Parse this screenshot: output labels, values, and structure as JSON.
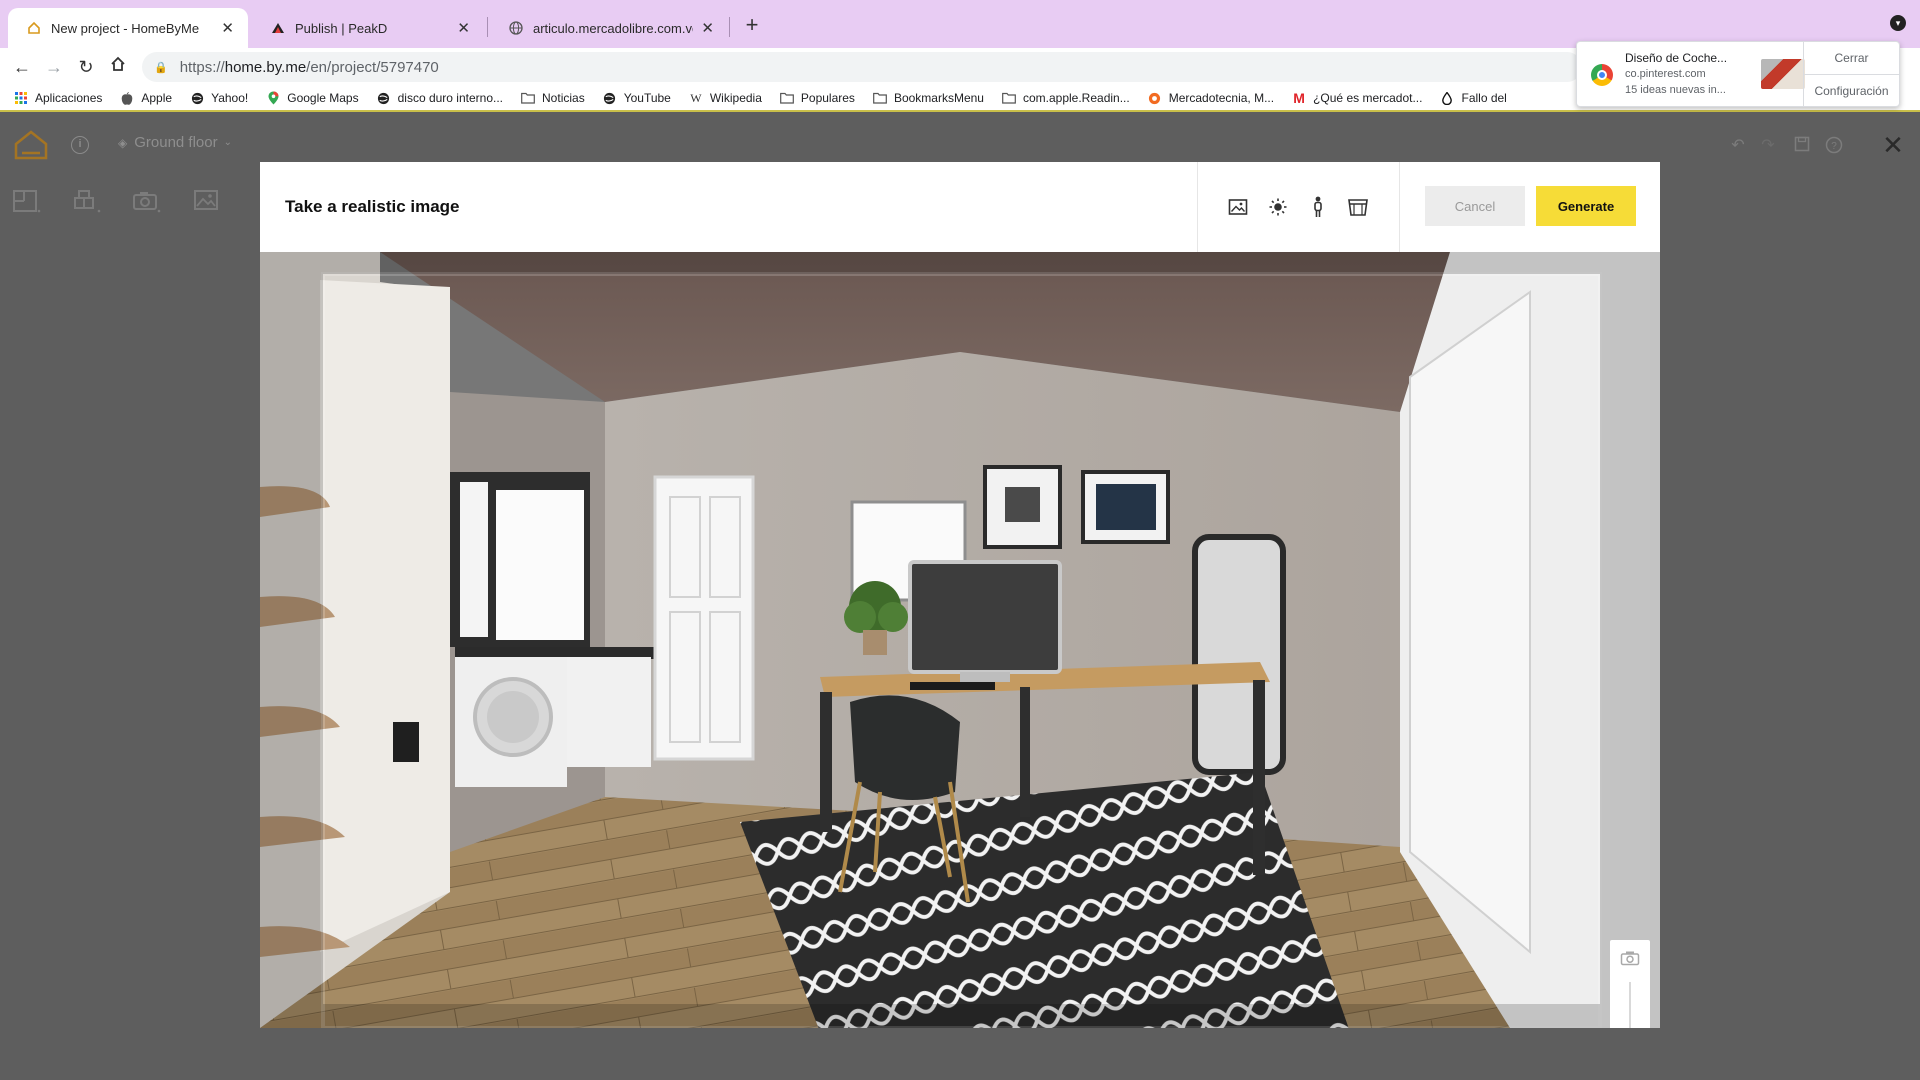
{
  "browser": {
    "tabs": [
      {
        "title": "New project - HomeByMe",
        "active": true,
        "favicon": "homebyme-icon"
      },
      {
        "title": "Publish | PeakD",
        "active": false,
        "favicon": "peakd-icon"
      },
      {
        "title": "articulo.mercadolibre.com.ve",
        "active": false,
        "favicon": "globe-icon"
      }
    ],
    "address": {
      "scheme": "https://",
      "host": "home.by.me",
      "path": "/en/project/5797470"
    },
    "bookmarks": [
      {
        "label": "Aplicaciones",
        "icon": "apps-grid-icon"
      },
      {
        "label": "Apple",
        "icon": "apple-icon"
      },
      {
        "label": "Yahoo!",
        "icon": "globe-icon"
      },
      {
        "label": "Google Maps",
        "icon": "map-pin-icon"
      },
      {
        "label": "disco duro interno...",
        "icon": "globe-icon"
      },
      {
        "label": "Noticias",
        "icon": "folder-icon"
      },
      {
        "label": "YouTube",
        "icon": "globe-icon"
      },
      {
        "label": "Wikipedia",
        "icon": "wikipedia-icon"
      },
      {
        "label": "Populares",
        "icon": "folder-icon"
      },
      {
        "label": "BookmarksMenu",
        "icon": "folder-icon"
      },
      {
        "label": "com.apple.Readin...",
        "icon": "folder-icon"
      },
      {
        "label": "Mercadotecnia, M...",
        "icon": "orange-circle-icon"
      },
      {
        "label": "¿Qué es mercadot...",
        "icon": "m-logo-icon"
      },
      {
        "label": "Fallo del",
        "icon": "drop-icon"
      }
    ]
  },
  "notification": {
    "title": "Diseño de Coche...",
    "source": "co.pinterest.com",
    "body": "15 ideas nuevas in...",
    "close_label": "Cerrar",
    "settings_label": "Configuración"
  },
  "app": {
    "floor_label": "Ground floor",
    "accent_color": "#d99a1e"
  },
  "modal": {
    "title": "Take a realistic image",
    "cancel_label": "Cancel",
    "generate_label": "Generate",
    "mode_icons": [
      "image-format-icon",
      "sun-icon",
      "person-icon",
      "scene-icon"
    ],
    "zoom_level": 0.45
  }
}
